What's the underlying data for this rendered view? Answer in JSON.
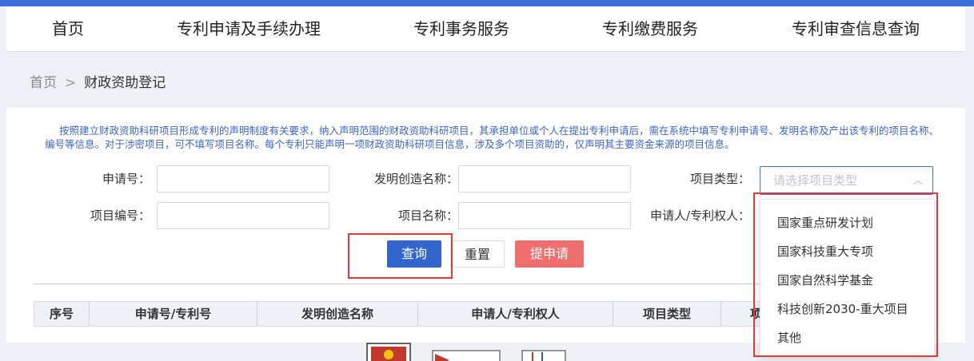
{
  "nav": {
    "items": [
      {
        "label": "首页"
      },
      {
        "label": "专利申请及手续办理"
      },
      {
        "label": "专利事务服务"
      },
      {
        "label": "专利缴费服务"
      },
      {
        "label": "专利审查信息查询"
      }
    ]
  },
  "breadcrumb": {
    "home": "首页",
    "separator": ">",
    "current": "财政资助登记"
  },
  "notice": "按照建立财政资助科研项目形成专利的声明制度有关要求，纳入声明范围的财政资助科研项目，其承担单位或个人在提出专利申请后，需在系统中填写专利申请号、发明名称及产出该专利的项目名称、编号等信息。对于涉密项目，可不填写项目名称。每个专利只能声明一项财政资助科研项目信息，涉及多个项目资助的，仅声明其主要资金来源的项目信息。",
  "form": {
    "application_no_label": "申请号：",
    "application_no_value": "",
    "invention_name_label": "发明创造名称：",
    "invention_name_value": "",
    "project_type_label": "项目类型：",
    "project_type_placeholder": "请选择项目类型",
    "project_no_label": "项目编号：",
    "project_no_value": "",
    "project_name_label": "项目名称：",
    "project_name_value": "",
    "applicant_label": "申请人/专利权人："
  },
  "buttons": {
    "query": "查询",
    "reset": "重置",
    "submit": "提申请"
  },
  "table": {
    "headers": [
      "序号",
      "申请号/专利号",
      "发明创造名称",
      "申请人/专利权人",
      "项目类型",
      "项"
    ]
  },
  "dropdown": {
    "options": [
      "国家重点研发计划",
      "国家科技重大专项",
      "国家自然科学基金",
      "科技创新2030-重大项目",
      "其他"
    ]
  },
  "colors": {
    "primary": "#3366cc",
    "danger": "#ef6f6f",
    "notice_text": "#3a66c9",
    "highlight": "#e53935"
  }
}
